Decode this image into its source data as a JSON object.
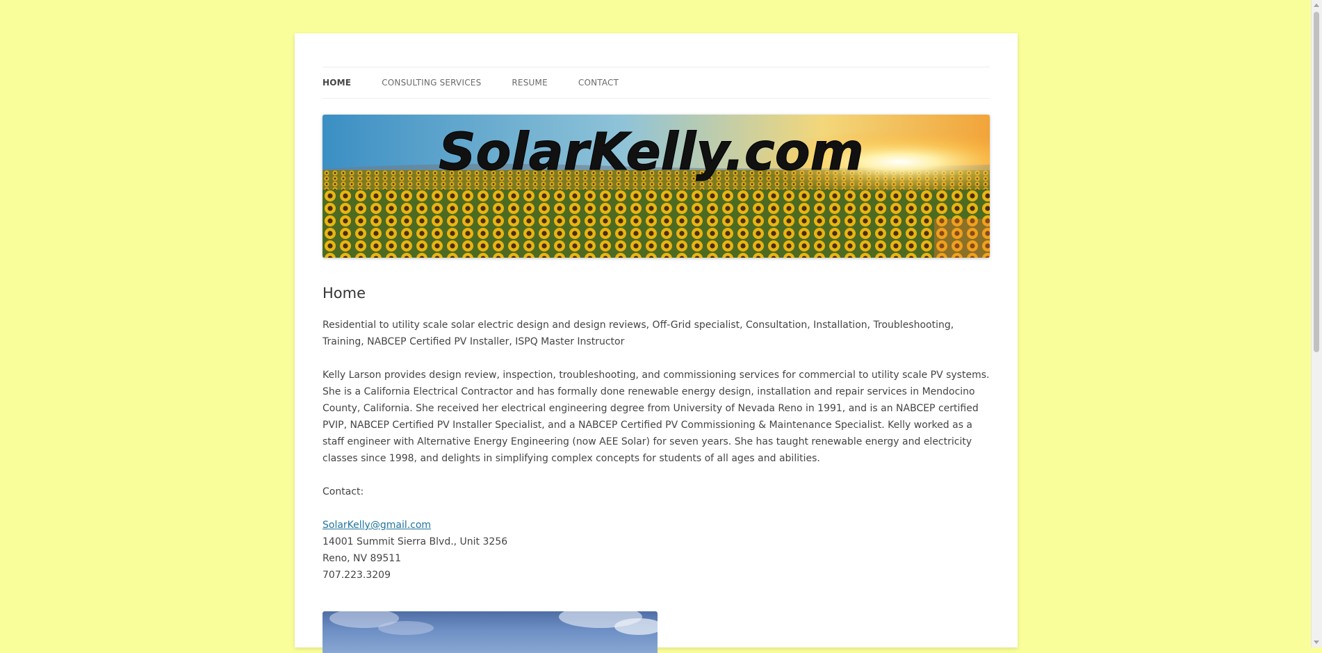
{
  "nav": {
    "items": [
      {
        "label": "HOME",
        "current": true
      },
      {
        "label": "CONSULTING SERVICES",
        "current": false
      },
      {
        "label": "RESUME",
        "current": false
      },
      {
        "label": "CONTACT",
        "current": false
      }
    ]
  },
  "banner": {
    "title": "SolarKelly.com"
  },
  "main": {
    "heading": "Home",
    "intro": "Residential to utility scale solar electric design and design reviews, Off-Grid specialist, Consultation, Installation, Troubleshooting, Training, NABCEP Certified PV Installer, ISPQ Master Instructor",
    "bio": "Kelly Larson provides design review, inspection, troubleshooting, and commissioning services for commercial to utility scale PV systems.  She is a California Electrical Contractor and has formally done renewable energy design, installation and repair services in Mendocino County, California. She received her electrical engineering degree from University of Nevada Reno in 1991, and is an NABCEP certified PVIP, NABCEP Certified PV Installer Specialist, and a NABCEP Certified PV Commissioning & Maintenance Specialist. Kelly worked as a staff engineer with Alternative Energy Engineering (now AEE Solar) for seven years. She has taught renewable energy and electricity classes since 1998, and delights in simplifying complex concepts for students of all ages and abilities.",
    "contact_label": "Contact:",
    "email": "SolarKelly@gmail.com",
    "address_line1": "14001 Summit Sierra Blvd., Unit 3256",
    "address_line2": "Reno, NV 89511",
    "phone": "707.223.3209"
  },
  "colors": {
    "page_background": "#fafe9a",
    "link": "#21759b",
    "text": "#444444"
  }
}
